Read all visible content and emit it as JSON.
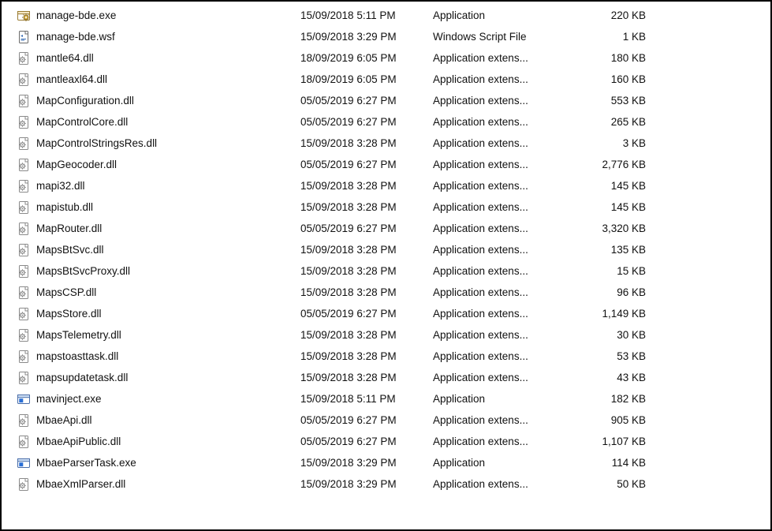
{
  "type_labels": {
    "exe": "Application",
    "dll": "Application extens...",
    "wsf": "Windows Script File"
  },
  "files": [
    {
      "icon": "exe-gear",
      "name": "manage-bde.exe",
      "date": "15/09/2018 5:11 PM",
      "type_key": "exe",
      "size": "220 KB"
    },
    {
      "icon": "wsf",
      "name": "manage-bde.wsf",
      "date": "15/09/2018 3:29 PM",
      "type_key": "wsf",
      "size": "1 KB"
    },
    {
      "icon": "dll",
      "name": "mantle64.dll",
      "date": "18/09/2019 6:05 PM",
      "type_key": "dll",
      "size": "180 KB"
    },
    {
      "icon": "dll",
      "name": "mantleaxl64.dll",
      "date": "18/09/2019 6:05 PM",
      "type_key": "dll",
      "size": "160 KB"
    },
    {
      "icon": "dll",
      "name": "MapConfiguration.dll",
      "date": "05/05/2019 6:27 PM",
      "type_key": "dll",
      "size": "553 KB"
    },
    {
      "icon": "dll",
      "name": "MapControlCore.dll",
      "date": "05/05/2019 6:27 PM",
      "type_key": "dll",
      "size": "265 KB"
    },
    {
      "icon": "dll",
      "name": "MapControlStringsRes.dll",
      "date": "15/09/2018 3:28 PM",
      "type_key": "dll",
      "size": "3 KB"
    },
    {
      "icon": "dll",
      "name": "MapGeocoder.dll",
      "date": "05/05/2019 6:27 PM",
      "type_key": "dll",
      "size": "2,776 KB"
    },
    {
      "icon": "dll",
      "name": "mapi32.dll",
      "date": "15/09/2018 3:28 PM",
      "type_key": "dll",
      "size": "145 KB"
    },
    {
      "icon": "dll",
      "name": "mapistub.dll",
      "date": "15/09/2018 3:28 PM",
      "type_key": "dll",
      "size": "145 KB"
    },
    {
      "icon": "dll",
      "name": "MapRouter.dll",
      "date": "05/05/2019 6:27 PM",
      "type_key": "dll",
      "size": "3,320 KB"
    },
    {
      "icon": "dll",
      "name": "MapsBtSvc.dll",
      "date": "15/09/2018 3:28 PM",
      "type_key": "dll",
      "size": "135 KB"
    },
    {
      "icon": "dll",
      "name": "MapsBtSvcProxy.dll",
      "date": "15/09/2018 3:28 PM",
      "type_key": "dll",
      "size": "15 KB"
    },
    {
      "icon": "dll",
      "name": "MapsCSP.dll",
      "date": "15/09/2018 3:28 PM",
      "type_key": "dll",
      "size": "96 KB"
    },
    {
      "icon": "dll",
      "name": "MapsStore.dll",
      "date": "05/05/2019 6:27 PM",
      "type_key": "dll",
      "size": "1,149 KB"
    },
    {
      "icon": "dll",
      "name": "MapsTelemetry.dll",
      "date": "15/09/2018 3:28 PM",
      "type_key": "dll",
      "size": "30 KB"
    },
    {
      "icon": "dll",
      "name": "mapstoasttask.dll",
      "date": "15/09/2018 3:28 PM",
      "type_key": "dll",
      "size": "53 KB"
    },
    {
      "icon": "dll",
      "name": "mapsupdatetask.dll",
      "date": "15/09/2018 3:28 PM",
      "type_key": "dll",
      "size": "43 KB"
    },
    {
      "icon": "exe-blue",
      "name": "mavinject.exe",
      "date": "15/09/2018 5:11 PM",
      "type_key": "exe",
      "size": "182 KB"
    },
    {
      "icon": "dll",
      "name": "MbaeApi.dll",
      "date": "05/05/2019 6:27 PM",
      "type_key": "dll",
      "size": "905 KB"
    },
    {
      "icon": "dll",
      "name": "MbaeApiPublic.dll",
      "date": "05/05/2019 6:27 PM",
      "type_key": "dll",
      "size": "1,107 KB"
    },
    {
      "icon": "exe-blue",
      "name": "MbaeParserTask.exe",
      "date": "15/09/2018 3:29 PM",
      "type_key": "exe",
      "size": "114 KB"
    },
    {
      "icon": "dll",
      "name": "MbaeXmlParser.dll",
      "date": "15/09/2018 3:29 PM",
      "type_key": "dll",
      "size": "50 KB"
    }
  ]
}
